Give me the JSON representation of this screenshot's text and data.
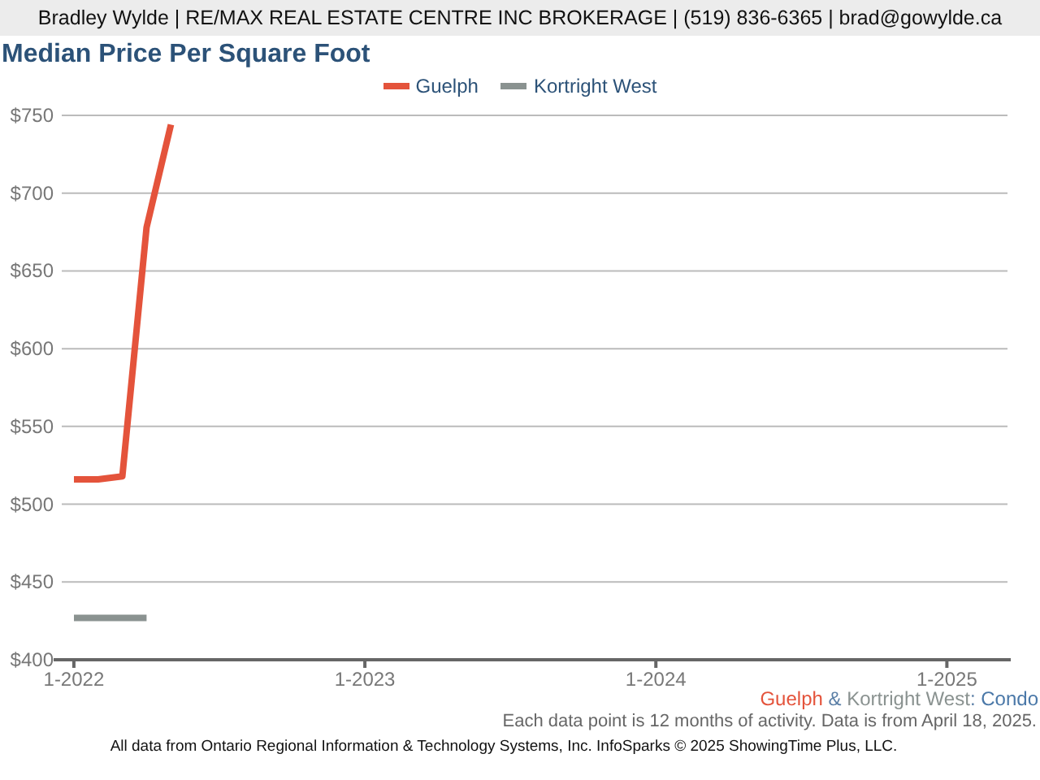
{
  "header": "Bradley Wylde | RE/MAX REAL ESTATE CENTRE INC BROKERAGE | (519) 836-6365 | brad@gowylde.ca",
  "title": "Median Price Per Square Foot",
  "chart_data": {
    "type": "line",
    "grid": true,
    "ylim": [
      400,
      750
    ],
    "categories": [
      "1-2022",
      null,
      null,
      null,
      null,
      null,
      null,
      null,
      null,
      null,
      null,
      null,
      "1-2023",
      null,
      null,
      null,
      null,
      null,
      null,
      null,
      null,
      null,
      null,
      null,
      "1-2024",
      null,
      null,
      null,
      null,
      null,
      null,
      null,
      null,
      null,
      null,
      null,
      "1-2025",
      null,
      null
    ],
    "yticks": [
      {
        "value": 400,
        "label": "$400"
      },
      {
        "value": 450,
        "label": "$450"
      },
      {
        "value": 500,
        "label": "$500"
      },
      {
        "value": 550,
        "label": "$550"
      },
      {
        "value": 600,
        "label": "$600"
      },
      {
        "value": 650,
        "label": "$650"
      },
      {
        "value": 700,
        "label": "$700"
      },
      {
        "value": 750,
        "label": "$750"
      }
    ],
    "series": [
      {
        "name": "Guelph",
        "color": "#e4533b",
        "values": [
          516,
          516,
          518,
          678,
          744,
          null,
          null,
          null,
          null,
          null,
          null,
          null,
          null,
          null,
          null,
          null,
          null,
          null,
          null,
          null,
          null,
          null,
          null,
          null,
          null,
          null,
          null,
          null,
          null,
          null,
          null,
          null,
          null,
          null,
          null,
          null,
          null,
          null,
          null
        ]
      },
      {
        "name": "Kortright West",
        "color": "#8a9290",
        "values": [
          427,
          427,
          427,
          427,
          null,
          null,
          null,
          null,
          null,
          null,
          null,
          null,
          null,
          null,
          null,
          null,
          null,
          null,
          null,
          null,
          null,
          null,
          null,
          null,
          null,
          null,
          null,
          null,
          null,
          null,
          null,
          null,
          null,
          null,
          null,
          null,
          null,
          null,
          null
        ]
      }
    ]
  },
  "caption": {
    "joiner": "&",
    "separator": ":",
    "property_type": "Condo"
  },
  "note": "Each data point is 12 months of activity. Data is from April 18, 2025.",
  "source": "All data from Ontario Regional Information & Technology Systems, Inc. InfoSparks © 2025 ShowingTime Plus, LLC."
}
